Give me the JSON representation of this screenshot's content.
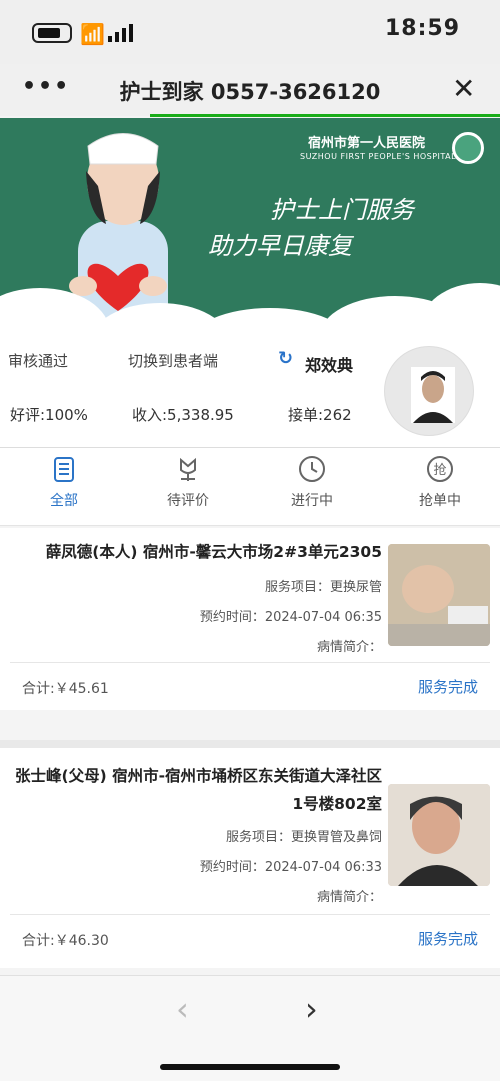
{
  "status": {
    "time": "18:59"
  },
  "nav": {
    "title": "护士到家 0557-3626120",
    "more": "•••",
    "close": "✕"
  },
  "banner": {
    "hospital_name": "宿州市第一人民医院",
    "hospital_en": "SUZHOU FIRST PEOPLE'S HOSPITAL",
    "line1": "护士上门服务",
    "line2": "助力早日康复",
    "colors": {
      "bg": "#2f7a5d"
    }
  },
  "profile": {
    "name": "郑效典",
    "refresh_icon": "↻",
    "switch_label": "切换到患者端",
    "review_label": "审核通过",
    "orders": "接单:262",
    "income": "收入:5,338.95",
    "rating": "好评:100%"
  },
  "tabs": [
    {
      "label": "抢单中",
      "icon": "grab-order-icon"
    },
    {
      "label": "进行中",
      "icon": "clock-icon"
    },
    {
      "label": "待评价",
      "icon": "flower-icon"
    },
    {
      "label": "全部",
      "icon": "list-icon",
      "active": true
    }
  ],
  "orders": [
    {
      "title": "薛凤德(本人) 宿州市-馨云大市场2#3单元2305",
      "service": "服务项目：更换尿管",
      "time": "预约时间：2024-07-04 06:35",
      "desc": "病情简介：",
      "status": "服务完成",
      "total": "合计:￥45.61"
    },
    {
      "title": "张士峰(父母) 宿州市-宿州市埇桥区东关街道大泽社区1号楼802室",
      "service": "服务项目：更换胃管及鼻饲",
      "time": "预约时间：2024-07-04 06:33",
      "desc": "病情简介：",
      "status": "服务完成",
      "total": "合计:￥46.30"
    }
  ],
  "bottom": {
    "back": "‹",
    "forward": "›"
  },
  "colors": {
    "accent": "#2b74c7",
    "progress": "#1aad19"
  }
}
